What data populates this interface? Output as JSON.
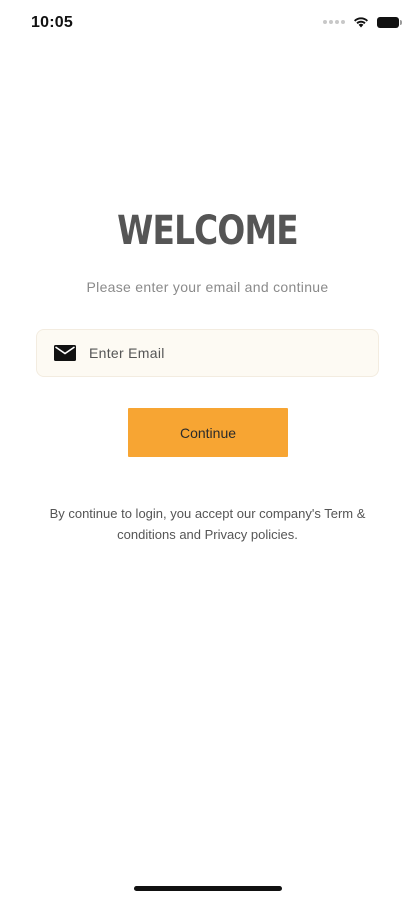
{
  "status_bar": {
    "time": "10:05",
    "icons": [
      "cellular-dots-icon",
      "wifi-icon",
      "battery-icon"
    ]
  },
  "welcome": {
    "title": "WELCOME",
    "subtitle": "Please enter your email and continue"
  },
  "email_field": {
    "icon": "mail-icon",
    "placeholder": "Enter Email",
    "value": ""
  },
  "continue_button": {
    "label": "Continue"
  },
  "terms": {
    "text": "By continue to login, you accept our company's Term & conditions and Privacy policies."
  },
  "colors": {
    "accent": "#f7a533",
    "field_background": "#fdfaf3",
    "title": "#555555",
    "subtitle": "#8a8a8a"
  }
}
